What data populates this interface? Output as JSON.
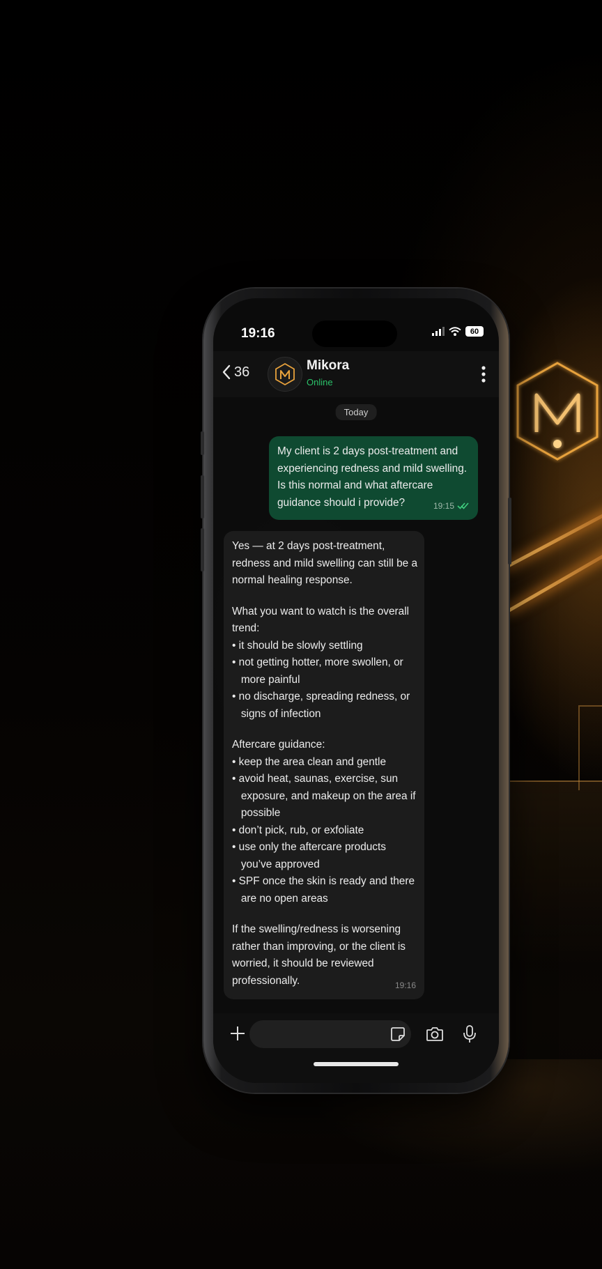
{
  "status_bar": {
    "time": "19:16",
    "battery": "60"
  },
  "header": {
    "back_count": "36",
    "contact_name": "Mikora",
    "contact_status": "Online",
    "avatar_letter": "M"
  },
  "chat": {
    "date_label": "Today",
    "outgoing": {
      "lines": [
        "My client is 2 days post-treatment and",
        "experiencing redness and mild swelling.",
        "Is this normal and what aftercare",
        "guidance should i provide?"
      ],
      "time": "19:15"
    },
    "incoming": {
      "lines": [
        "Yes — at 2 days post-treatment,",
        "redness and mild swelling can still be a",
        "normal healing response.",
        "",
        "What you want to watch is the overall",
        "trend:",
        "• it should be slowly settling",
        "• not getting hotter, more swollen, or",
        "   more painful",
        "• no discharge, spreading redness, or",
        "   signs of infection",
        "",
        "Aftercare guidance:",
        "• keep the area clean and gentle",
        "• avoid heat, saunas, exercise, sun",
        "   exposure, and makeup on the area if",
        "   possible",
        "• don’t pick, rub, or exfoliate",
        "• use only the aftercare products",
        "   you’ve approved",
        "• SPF once the skin is ready and there",
        "   are no open areas",
        "",
        "If the swelling/redness is worsening",
        "rather than improving, or the client is",
        "worried, it should be reviewed",
        "professionally."
      ],
      "time": "19:16"
    }
  },
  "composer": {
    "input_value": "",
    "input_placeholder": ""
  },
  "icons": {
    "back": "chevron-left-icon",
    "menu": "more-vertical-icon",
    "plus": "plus-icon",
    "sticker": "sticker-icon",
    "camera": "camera-icon",
    "mic": "microphone-icon",
    "read": "double-check-icon"
  },
  "colors": {
    "outgoing_bubble": "#0f4a31",
    "incoming_bubble": "#1c1c1c",
    "online": "#2bc36a",
    "accent_gold": "#e8a23c"
  }
}
